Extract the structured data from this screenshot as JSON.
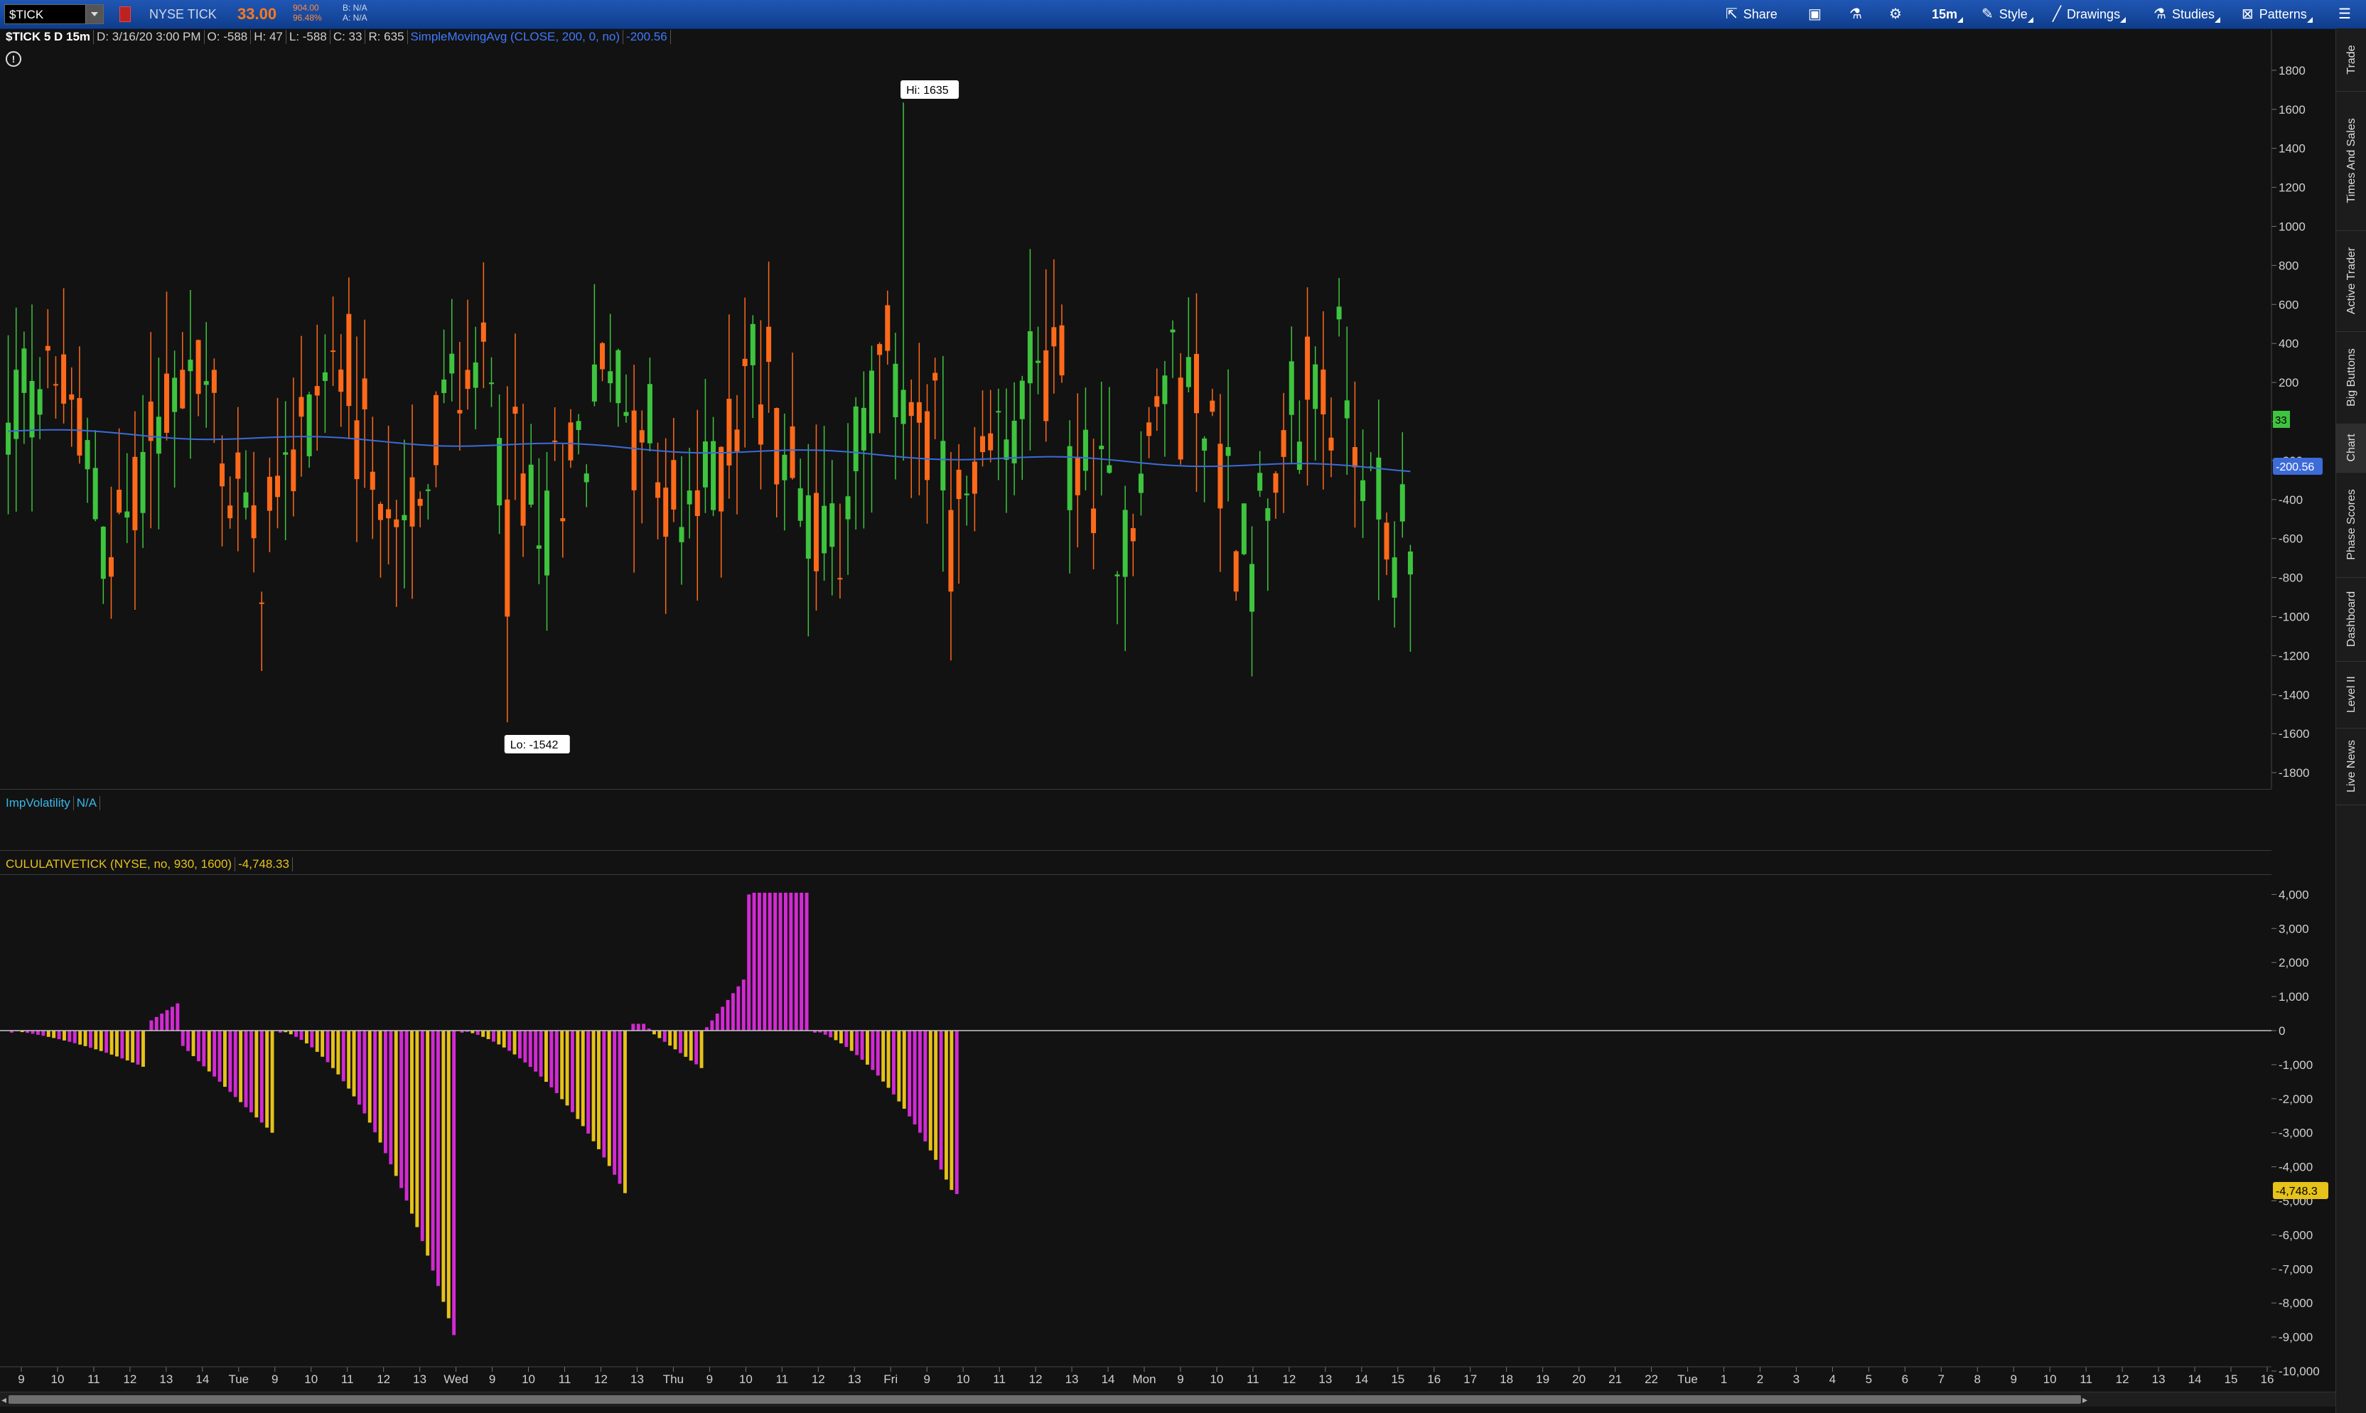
{
  "header": {
    "symbol": "$TICK",
    "description": "NYSE TICK",
    "last": "33.00",
    "change_top": "904.00",
    "change_pct": "96.48%",
    "bid": "B: N/A",
    "ask": "A: N/A",
    "buttons": [
      {
        "label": "Share",
        "icon": "share-icon"
      },
      {
        "label": "15m",
        "icon": "timeframe"
      },
      {
        "label": "Style",
        "icon": "style-icon"
      },
      {
        "label": "Drawings",
        "icon": "pencil-icon"
      },
      {
        "label": "Studies",
        "icon": "flask-icon"
      },
      {
        "label": "Patterns",
        "icon": "patterns-icon"
      }
    ]
  },
  "info_line": {
    "symbol_tf": "$TICK 5 D 15m",
    "date": "D: 3/16/20 3:00 PM",
    "open": "O: -588",
    "high": "H: 47",
    "low": "L: -588",
    "close": "C: 33",
    "range": "R: 635",
    "sma_label": "SimpleMovingAvg (CLOSE, 200, 0, no)",
    "sma_value": "-200.56"
  },
  "price_pane": {
    "y_ticks": [
      "1800",
      "1600",
      "1400",
      "1200",
      "1000",
      "800",
      "600",
      "400",
      "200",
      "0",
      "-200",
      "-400",
      "-600",
      "-800",
      "-1000",
      "-1200",
      "-1400",
      "-1600",
      "-1800"
    ],
    "hi_label": "Hi: 1635",
    "lo_label": "Lo: -1542",
    "last_badge": "33",
    "sma_badge": "-200.56",
    "colors": {
      "up": "#3ec43e",
      "down": "#ff6a1a",
      "sma": "#3d6bd8"
    }
  },
  "impvol": {
    "label": "ImpVolatility",
    "value": "N/A"
  },
  "cumtick": {
    "label": "CULULATIVETICK (NYSE, no, 930, 1600)",
    "value": "-4,748.33",
    "y_ticks": [
      "4,000",
      "3,000",
      "2,000",
      "1,000",
      "0",
      "-1,000",
      "-2,000",
      "-3,000",
      "-4,000",
      "-5,000",
      "-6,000",
      "-7,000",
      "-8,000",
      "-9,000",
      "-10,000"
    ],
    "badge": "-4,748.3",
    "colors": {
      "neg": "#e6c21a",
      "pos": "#d22ad2"
    }
  },
  "x_axis": [
    "9",
    "10",
    "11",
    "12",
    "13",
    "14",
    "Tue",
    "9",
    "10",
    "11",
    "12",
    "13",
    "Wed",
    "9",
    "10",
    "11",
    "12",
    "13",
    "Thu",
    "9",
    "10",
    "11",
    "12",
    "13",
    "Fri",
    "9",
    "10",
    "11",
    "12",
    "13",
    "14",
    "Mon",
    "9",
    "10",
    "11",
    "12",
    "13",
    "14",
    "15",
    "16",
    "17",
    "18",
    "19",
    "20",
    "21",
    "22",
    "Tue",
    "1",
    "2",
    "3",
    "4",
    "5",
    "6",
    "7",
    "8",
    "9",
    "10",
    "11",
    "12",
    "13",
    "14",
    "15",
    "16"
  ],
  "right_tabs": [
    "Trade",
    "Times And Sales",
    "Active Trader",
    "Big Buttons",
    "Chart",
    "Phase Scores",
    "Dashboard",
    "Level II",
    "Live News"
  ]
}
